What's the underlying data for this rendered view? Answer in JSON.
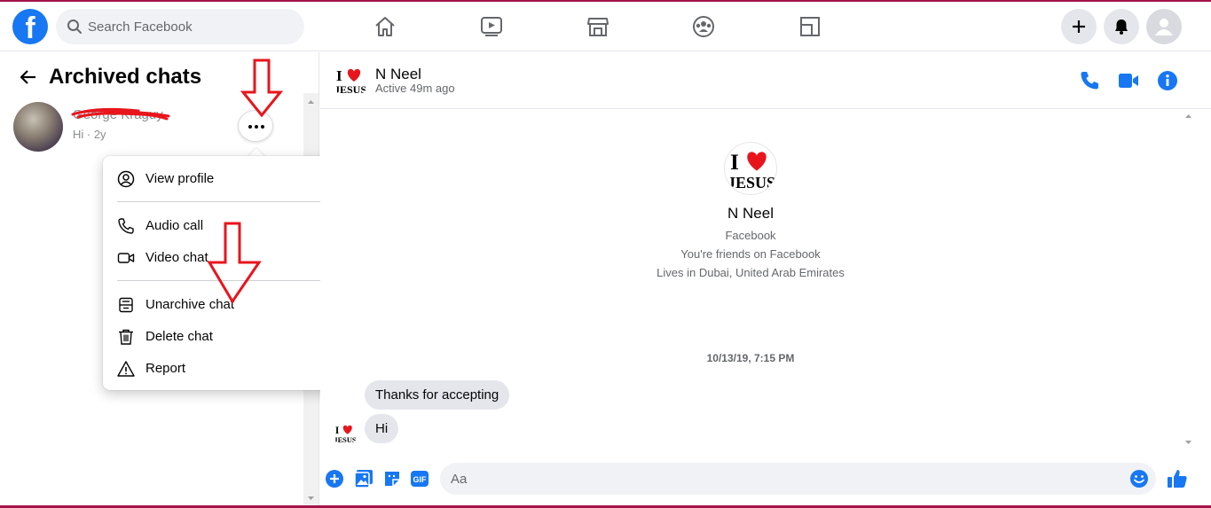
{
  "search": {
    "placeholder": "Search Facebook"
  },
  "left_panel": {
    "title": "Archived chats",
    "chats": [
      {
        "name": "George Kraguy",
        "snippet": "Hi · 2y"
      }
    ]
  },
  "menu": {
    "items": [
      {
        "label": "View profile",
        "icon": "user-circle-icon"
      },
      {
        "label": "Audio call",
        "icon": "phone-icon"
      },
      {
        "label": "Video chat",
        "icon": "video-camera-icon"
      },
      {
        "label": "Unarchive chat",
        "icon": "unarchive-icon"
      },
      {
        "label": "Delete chat",
        "icon": "trash-icon"
      },
      {
        "label": "Report",
        "icon": "warning-icon"
      }
    ]
  },
  "conversation": {
    "name": "N Neel",
    "status": "Active 49m ago",
    "profile": {
      "name": "N Neel",
      "line1": "Facebook",
      "line2": "You're friends on Facebook",
      "line3": "Lives in Dubai, United Arab Emirates"
    },
    "timestamp": "10/13/19, 7:15 PM",
    "messages": [
      {
        "text": "Thanks for accepting"
      },
      {
        "text": "Hi"
      }
    ],
    "composer_placeholder": "Aa",
    "avatar_text": {
      "top": "I",
      "bottom": "JESUS"
    }
  },
  "colors": {
    "facebook_blue": "#1877f2",
    "annotation_red": "#e8151c",
    "frame": "#a3144a"
  }
}
